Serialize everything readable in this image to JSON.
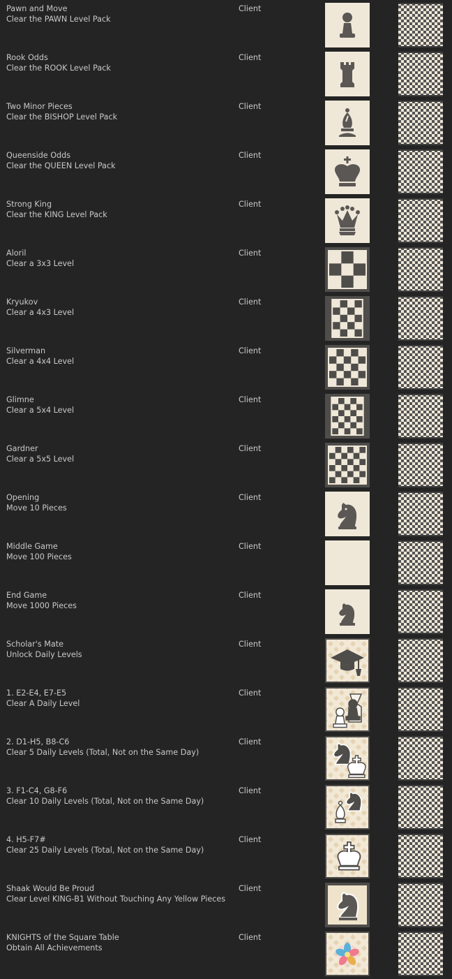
{
  "achievements": [
    {
      "name": "Pawn and Move",
      "description": "Clear the PAWN Level Pack",
      "type": "Client",
      "icon": "pawn-icon"
    },
    {
      "name": "Rook Odds",
      "description": "Clear the ROOK Level Pack",
      "type": "Client",
      "icon": "rook-icon"
    },
    {
      "name": "Two Minor Pieces",
      "description": "Clear the BISHOP Level Pack",
      "type": "Client",
      "icon": "bishop-icon"
    },
    {
      "name": "Queenside Odds",
      "description": "Clear the QUEEN Level Pack",
      "type": "Client",
      "icon": "king-crown-icon"
    },
    {
      "name": "Strong King",
      "description": "Clear the KING Level Pack",
      "type": "Client",
      "icon": "queen-crown-icon"
    },
    {
      "name": "Aloril",
      "description": "Clear a 3x3 Level",
      "type": "Client",
      "icon": "board-3x3-icon"
    },
    {
      "name": "Kryukov",
      "description": "Clear a 4x3 Level",
      "type": "Client",
      "icon": "board-4x3-icon"
    },
    {
      "name": "Silverman",
      "description": "Clear a 4x4 Level",
      "type": "Client",
      "icon": "board-4x4-icon"
    },
    {
      "name": "Glimne",
      "description": "Clear a 5x4 Level",
      "type": "Client",
      "icon": "board-5x4-icon"
    },
    {
      "name": "Gardner",
      "description": "Clear a 5x5 Level",
      "type": "Client",
      "icon": "board-5x5-icon"
    },
    {
      "name": "Opening",
      "description": "Move 10 Pieces",
      "type": "Client",
      "icon": "knight-icon"
    },
    {
      "name": "Middle Game",
      "description": "Move 100 Pieces",
      "type": "Client",
      "icon": "blank-icon"
    },
    {
      "name": "End Game",
      "description": "Move 1000 Pieces",
      "type": "Client",
      "icon": "knight-small-icon"
    },
    {
      "name": "Scholar's Mate",
      "description": "Unlock Daily Levels",
      "type": "Client",
      "icon": "graduation-cap-icon"
    },
    {
      "name": "1. E2-E4, E7-E5",
      "description": "Clear A Daily Level",
      "type": "Client",
      "icon": "pawns-icon"
    },
    {
      "name": "2. D1-H5, B8-C6",
      "description": "Clear 5 Daily Levels (Total, Not on the Same Day)",
      "type": "Client",
      "icon": "knight-king-icon"
    },
    {
      "name": "3. F1-C4, G8-F6",
      "description": "Clear 10 Daily Levels (Total, Not on the Same Day)",
      "type": "Client",
      "icon": "bishop-knight-icon"
    },
    {
      "name": "4. H5-F7#",
      "description": "Clear 25 Daily Levels (Total, Not on the Same Day)",
      "type": "Client",
      "icon": "king-outline-icon"
    },
    {
      "name": "Shaak Would Be Proud",
      "description": "Clear Level KING-B1 Without Touching Any Yellow Pieces",
      "type": "Client",
      "icon": "knight-frame-icon"
    },
    {
      "name": "KNIGHTS of the Square Table",
      "description": "Obtain All Achievements",
      "type": "Client",
      "icon": "flower-icon"
    }
  ],
  "colors": {
    "background": "#242424",
    "text": "#c9c9c9",
    "cream": "#efe7d8",
    "piece": "#5a5754"
  }
}
